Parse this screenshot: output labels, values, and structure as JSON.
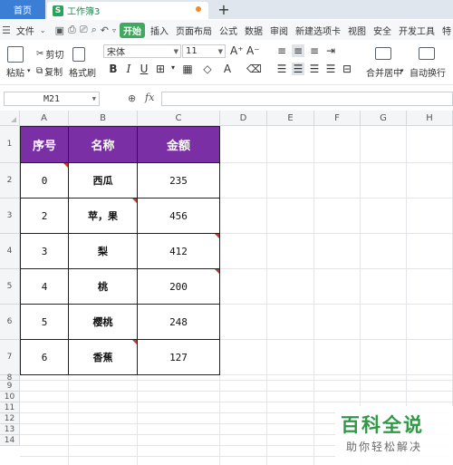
{
  "tabs": {
    "home": "首页",
    "workbook_icon": "S",
    "workbook": "工作簿3",
    "add": "+"
  },
  "menu": {
    "file": "文件",
    "active": "开始",
    "items": [
      "插入",
      "页面布局",
      "公式",
      "数据",
      "审阅",
      "新建选项卡",
      "视图",
      "安全",
      "开发工具",
      "特"
    ]
  },
  "ribbon": {
    "paste": "粘贴",
    "cut": "剪切",
    "copy": "复制",
    "format_painter": "格式刷",
    "font_name": "宋体",
    "font_size": "11",
    "bold": "B",
    "italic": "I",
    "underline": "U",
    "merge_center": "合并居中",
    "wrap_text": "自动换行"
  },
  "formula_bar": {
    "name_box": "M21",
    "fx": "fx",
    "formula": ""
  },
  "columns": [
    "A",
    "B",
    "C",
    "D",
    "E",
    "F",
    "G",
    "H"
  ],
  "rows": [
    "1",
    "2",
    "3",
    "4",
    "5",
    "6",
    "7",
    "8",
    "9",
    "10",
    "11",
    "12",
    "13",
    "14"
  ],
  "table": {
    "headers": [
      "序号",
      "名称",
      "金额"
    ],
    "data": [
      [
        "0",
        "西瓜",
        "235"
      ],
      [
        "2",
        "苹，果",
        "456"
      ],
      [
        "3",
        "梨",
        "412"
      ],
      [
        "4",
        "桃",
        "200"
      ],
      [
        "5",
        "樱桃",
        "248"
      ],
      [
        "6",
        "香蕉",
        "127"
      ]
    ]
  },
  "watermark": {
    "title": "百科全说",
    "subtitle": "助你轻松解决"
  },
  "colors": {
    "header_fill": "#7b2fa5",
    "accent": "#3faa5f",
    "home_tab": "#3b7ed6"
  }
}
